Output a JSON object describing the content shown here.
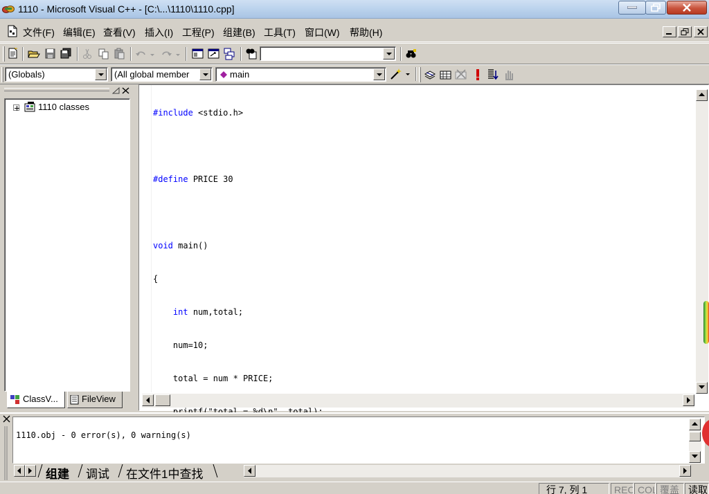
{
  "window": {
    "title": "1110 - Microsoft Visual C++ - [C:\\...\\1110\\1110.cpp]"
  },
  "menu": {
    "items": [
      "文件(F)",
      "编辑(E)",
      "查看(V)",
      "插入(I)",
      "工程(P)",
      "组建(B)",
      "工具(T)",
      "窗口(W)",
      "帮助(H)"
    ]
  },
  "toolbar2": {
    "scope_combo": "(Globals)",
    "members_combo": "(All global member",
    "function_combo": "main"
  },
  "workspace": {
    "tree_root": "1110 classes",
    "tabs": [
      "ClassV...",
      "FileView"
    ]
  },
  "editor": {
    "lines": [
      "#include <stdio.h>",
      "",
      "#define PRICE 30",
      "",
      "void main()",
      "{",
      "    int num,total;",
      "    num=10;",
      "    total = num * PRICE;",
      "    printf(\"total = %d\\n\", total);",
      "}"
    ]
  },
  "output": {
    "message": "1110.obj - 0 error(s), 0 warning(s)",
    "tabs": [
      "组建",
      "调试",
      "在文件1中查找"
    ]
  },
  "status": {
    "position": "行 7, 列 1",
    "rec": "REC",
    "col": "COL",
    "ovr": "覆盖",
    "read": "读取"
  }
}
